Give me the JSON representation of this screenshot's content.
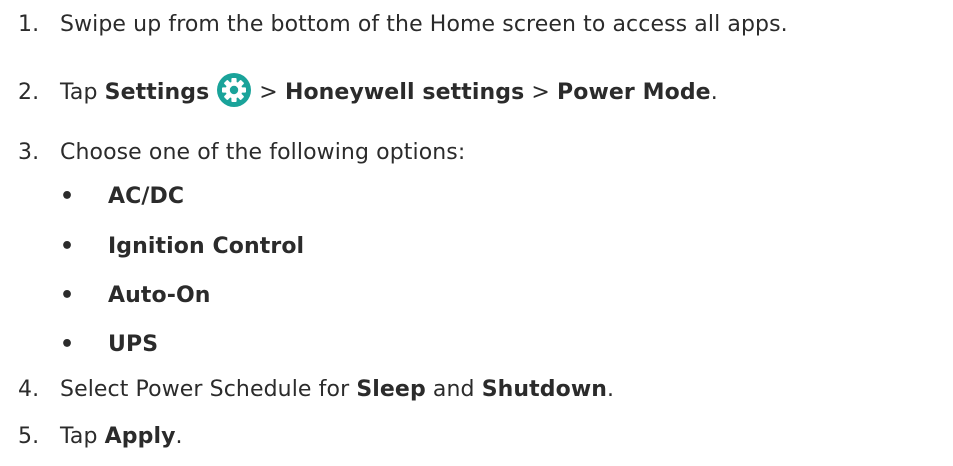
{
  "steps": {
    "s1": {
      "num": "1.",
      "text": "Swipe up from the bottom of the Home screen to access all apps."
    },
    "s2": {
      "num": "2.",
      "tap": "Tap",
      "settings": "Settings",
      "sep1": ">",
      "honeywell": "Honeywell settings",
      "sep2": ">",
      "power_mode": "Power Mode",
      "end": "."
    },
    "s3": {
      "num": "3.",
      "text": "Choose one of the following options:"
    },
    "options": [
      {
        "bullet": "•",
        "label": "AC/DC"
      },
      {
        "bullet": "•",
        "label": "Ignition Control"
      },
      {
        "bullet": "•",
        "label": "Auto-On"
      },
      {
        "bullet": "•",
        "label": "UPS"
      }
    ],
    "s4": {
      "num": "4.",
      "pre": "Select Power Schedule for",
      "sleep": "Sleep",
      "and": "and",
      "shutdown": "Shutdown",
      "end": "."
    },
    "s5": {
      "num": "5.",
      "tap": "Tap",
      "apply": "Apply",
      "end": "."
    }
  },
  "colors": {
    "text": "#2b2b2b",
    "settings_icon_bg": "#1aa39a",
    "settings_icon_fg": "#ffffff"
  },
  "icons": {
    "settings": "gear-icon"
  }
}
